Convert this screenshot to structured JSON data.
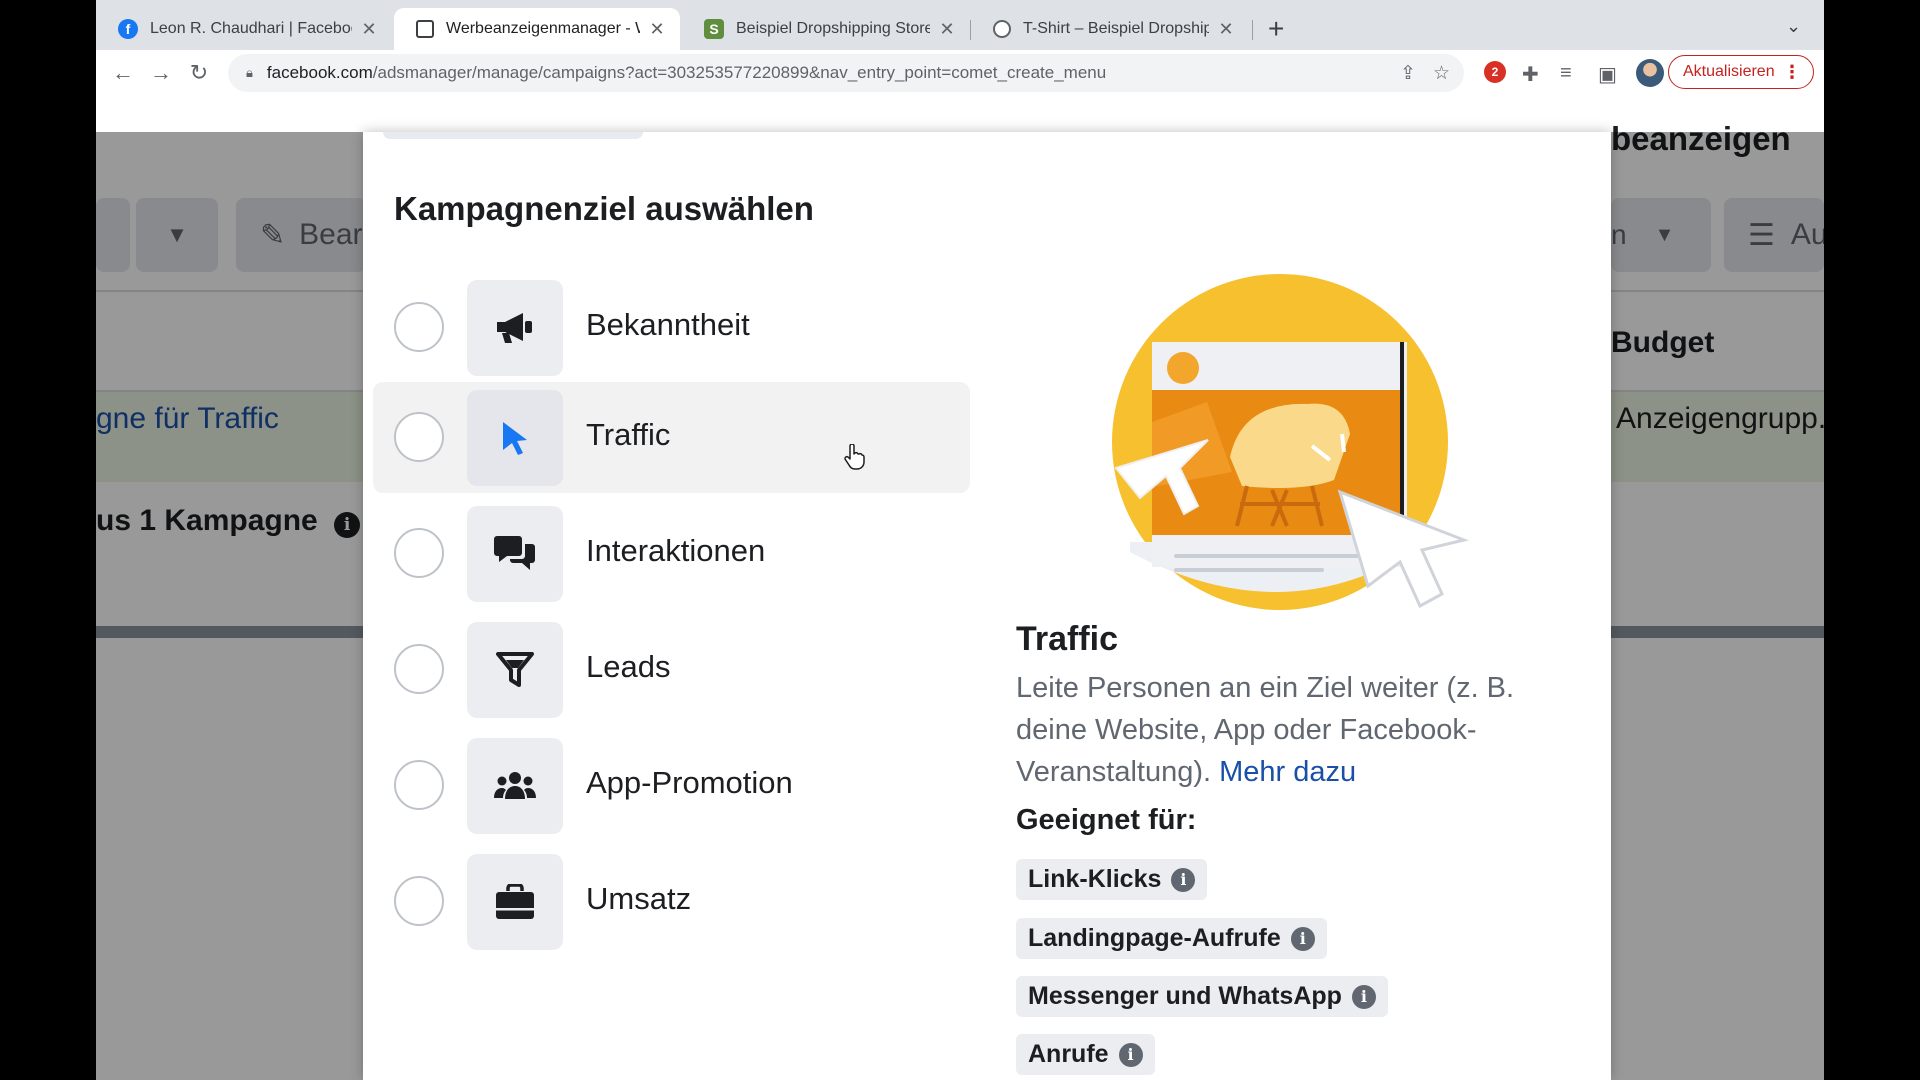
{
  "browser": {
    "tabs": [
      {
        "title": "Leon R. Chaudhari | Facebook",
        "icon": "facebook-icon"
      },
      {
        "title": "Werbeanzeigenmanager - Werbeanzeigen",
        "icon": "ads-manager-icon",
        "active": true
      },
      {
        "title": "Beispiel Dropshipping Store · Home",
        "icon": "shopify-icon"
      },
      {
        "title": "T-Shirt – Beispiel Dropshipping Store",
        "icon": "globe-icon"
      }
    ],
    "new_tab": "+",
    "url_host": "facebook.com",
    "url_path": "/adsmanager/manage/campaigns?act=303253577220899&nav_entry_point=comet_create_menu",
    "extension_badge": "2",
    "update_label": "Aktualisieren"
  },
  "background": {
    "edit_label": "Bear",
    "heading_partial": "beanzeigen",
    "right_btn_partial": "n",
    "right_btn2_partial": "Au",
    "budget_label": "Budget",
    "campaign_name_partial": "gne für Traffic",
    "adgroup_partial": "Anzeigengrupp...",
    "summary_partial": "us 1 Kampagne"
  },
  "modal": {
    "title": "Kampagnenziel auswählen",
    "options": [
      {
        "label": "Bekanntheit",
        "icon": "megaphone-icon"
      },
      {
        "label": "Traffic",
        "icon": "cursor-icon"
      },
      {
        "label": "Interaktionen",
        "icon": "chat-bubbles-icon"
      },
      {
        "label": "Leads",
        "icon": "funnel-icon"
      },
      {
        "label": "App-Promotion",
        "icon": "people-icon"
      },
      {
        "label": "Umsatz",
        "icon": "briefcase-icon"
      }
    ],
    "hovered_option": "Traffic",
    "detail": {
      "title": "Traffic",
      "description": "Leite Personen an ein Ziel weiter (z. B. deine Website, App oder Facebook-Veranstaltung).",
      "more_link": "Mehr dazu",
      "suitable_title": "Geeignet für:",
      "suitable_for": [
        "Link-Klicks",
        "Landingpage-Aufrufe",
        "Messenger und WhatsApp",
        "Anrufe"
      ]
    }
  },
  "colors": {
    "accent_blue": "#1877f2",
    "link_blue": "#1a4fa8",
    "update_red": "#c5221f",
    "illustration_yellow": "#f7c02f",
    "illustration_orange": "#e98a13"
  }
}
